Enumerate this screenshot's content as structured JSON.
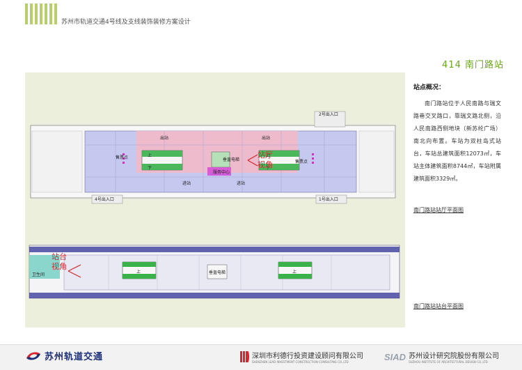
{
  "header": {
    "project_title": "苏州市轨道交通4号线及支线装饰装修方案设计",
    "station_title": "414 南门路站"
  },
  "overview": {
    "heading": "站点概况：",
    "body": "南门路站位于人民南路与瑞文路巷交叉路口，靠瑞文路北侧，沿人民南路西侧地块（新苏纶广场）南北向布置。车站为双柱岛式站台，车站总建筑面积12073㎡，车站主体建筑面积8744㎡，车站附属建筑面积3329㎡。",
    "concourse_link": "南门路站站厅平面图",
    "platform_link": "南门路站站台平面图"
  },
  "concourse_plan": {
    "exit2": "2号出入口",
    "exit4": "4号出入口",
    "exit1": "1号出入口",
    "ticket_left": "售票点",
    "ticket_right": "售票点",
    "outbound_left": "出站",
    "outbound_right": "出站",
    "inbound_left": "进站",
    "inbound_right": "进站",
    "elevator": "垂直电梯",
    "service": "服务中心",
    "up1": "上",
    "down1": "下",
    "up2": "上",
    "down2": "下",
    "view_label_line1": "站厅",
    "view_label_line2": "视角"
  },
  "platform_plan": {
    "restroom": "卫生间",
    "elevator": "垂直电梯",
    "up1": "上",
    "up2": "上",
    "view_label_line1": "站台",
    "view_label_line2": "视角"
  },
  "footer": {
    "metro_brand": "苏州轨道交通",
    "lead_cn": "深圳市利德行投资建设顾问有限公司",
    "lead_en": "SHENZHEN LEAD INVESTMENT CONSTRUCTION CONSULTING CO.,LTD",
    "siad_brand": "SIAD",
    "siad_cn": "苏州设计研究院股份有限公司",
    "siad_en": "SUZHOU INSTITUTE OF ARCHITECTURAL DESIGN CO.,LTD"
  },
  "colors": {
    "accent_green": "#6aa21a",
    "panel_bg": "#ecefdc",
    "view_red": "#d8262e",
    "outbound_pink": "#f5b8c6",
    "concourse_blue": "#c5c8ef"
  }
}
